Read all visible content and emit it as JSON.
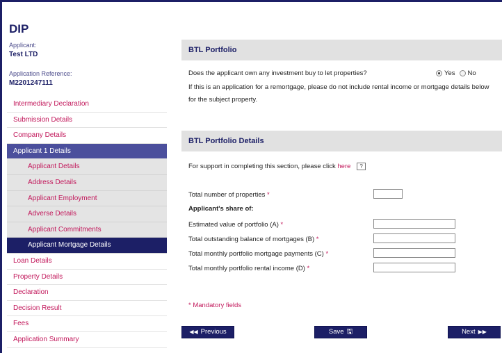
{
  "sidebar": {
    "title": "DIP",
    "applicant_label": "Applicant:",
    "applicant_value": "Test LTD",
    "ref_label": "Application Reference:",
    "ref_value": "M2201247111",
    "items": [
      {
        "label": "Intermediary Declaration"
      },
      {
        "label": "Submission Details"
      },
      {
        "label": "Company Details"
      },
      {
        "label": "Applicant 1 Details"
      },
      {
        "label": "Applicant Details"
      },
      {
        "label": "Address Details"
      },
      {
        "label": "Applicant Employment"
      },
      {
        "label": "Adverse Details"
      },
      {
        "label": "Applicant Commitments"
      },
      {
        "label": "Applicant Mortgage Details"
      },
      {
        "label": "Loan Details"
      },
      {
        "label": "Property Details"
      },
      {
        "label": "Declaration"
      },
      {
        "label": "Decision Result"
      },
      {
        "label": "Fees"
      },
      {
        "label": "Application Summary"
      }
    ]
  },
  "portfolio": {
    "heading": "BTL Portfolio",
    "question": "Does the applicant own any investment buy to let properties?",
    "yes_label": "Yes",
    "no_label": "No",
    "note_line1": "If this is an application for a remortgage, please do not include rental income or mortgage details below",
    "note_line2": "for the subject property."
  },
  "details": {
    "heading": "BTL Portfolio Details",
    "support_text": "For support in completing this section, please click",
    "support_link": "here",
    "help_glyph": "?",
    "total_properties": "Total number of properties",
    "share_heading": "Applicant's share of:",
    "estimated_value": "Estimated value of portfolio (A)",
    "outstanding_balance": "Total outstanding balance of mortgages (B)",
    "monthly_payments": "Total monthly portfolio mortgage payments (C)",
    "rental_income": "Total monthly portfolio rental income (D)",
    "required_mark": "*",
    "mandatory_note": "* Mandatory fields"
  },
  "buttons": {
    "previous": "Previous",
    "previous_glyph": "◀◀",
    "save": "Save",
    "save_glyph": "🖫",
    "next": "Next",
    "next_glyph": "▶▶"
  }
}
